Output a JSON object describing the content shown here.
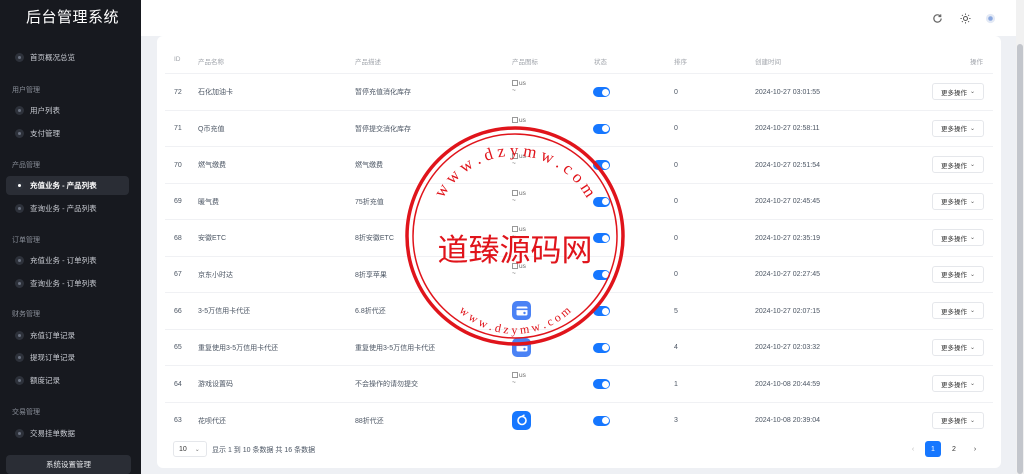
{
  "app": {
    "title": "后台管理系统"
  },
  "sidebar": {
    "groups": [
      {
        "title": "",
        "items": [
          {
            "label": "首页概况总览",
            "active": false
          }
        ]
      },
      {
        "title": "用户管理",
        "items": [
          {
            "label": "用户列表",
            "active": false
          },
          {
            "label": "支付管理",
            "active": false
          }
        ]
      },
      {
        "title": "产品管理",
        "items": [
          {
            "label": "充值业务 - 产品列表",
            "active": true
          },
          {
            "label": "查询业务 - 产品列表",
            "active": false
          }
        ]
      },
      {
        "title": "订单管理",
        "items": [
          {
            "label": "充值业务 - 订单列表",
            "active": false
          },
          {
            "label": "查询业务 - 订单列表",
            "active": false
          }
        ]
      },
      {
        "title": "财务管理",
        "items": [
          {
            "label": "充值订单记录",
            "active": false
          },
          {
            "label": "提现订单记录",
            "active": false
          },
          {
            "label": "额度记录",
            "active": false
          }
        ]
      },
      {
        "title": "交易管理",
        "items": [
          {
            "label": "交易挂单数据",
            "active": false
          }
        ]
      }
    ],
    "system_button": "系统设置管理"
  },
  "header": {
    "icons": [
      "refresh-icon",
      "sun-icon",
      "avatar-icon"
    ]
  },
  "table": {
    "columns": [
      "ID",
      "产品名称",
      "产品描述",
      "产品图标",
      "状态",
      "排序",
      "创建时间",
      "操作"
    ],
    "rows": [
      {
        "id": "72",
        "name": "石化加油卡",
        "desc": "暂停充值消化库存",
        "icon": "broken",
        "icon_text": "us\n~",
        "status": true,
        "sort": "0",
        "created": "2024-10-27 03:01:55",
        "action": "更多操作"
      },
      {
        "id": "71",
        "name": "Q币充值",
        "desc": "暂停提交消化库存",
        "icon": "broken",
        "icon_text": "us\n~",
        "status": true,
        "sort": "0",
        "created": "2024-10-27 02:58:11",
        "action": "更多操作"
      },
      {
        "id": "70",
        "name": "燃气缴费",
        "desc": "燃气缴费",
        "icon": "broken",
        "icon_text": "us\n~",
        "status": true,
        "sort": "0",
        "created": "2024-10-27 02:51:54",
        "action": "更多操作"
      },
      {
        "id": "69",
        "name": "暖气费",
        "desc": "75折充值",
        "icon": "broken",
        "icon_text": "us\n~",
        "status": true,
        "sort": "0",
        "created": "2024-10-27 02:45:45",
        "action": "更多操作"
      },
      {
        "id": "68",
        "name": "安徽ETC",
        "desc": "8折安徽ETC",
        "icon": "broken",
        "icon_text": "us\n~",
        "status": true,
        "sort": "0",
        "created": "2024-10-27 02:35:19",
        "action": "更多操作"
      },
      {
        "id": "67",
        "name": "京东小时达",
        "desc": "8折享苹果",
        "icon": "broken",
        "icon_text": "us\n~",
        "status": true,
        "sort": "0",
        "created": "2024-10-27 02:27:45",
        "action": "更多操作"
      },
      {
        "id": "66",
        "name": "3-5万信用卡代还",
        "desc": "6.8折代还",
        "icon": "card",
        "icon_text": "",
        "status": true,
        "sort": "5",
        "created": "2024-10-27 02:07:15",
        "action": "更多操作"
      },
      {
        "id": "65",
        "name": "重复使用3-5万信用卡代还",
        "desc": "重复使用3-5万信用卡代还",
        "icon": "card",
        "icon_text": "",
        "status": true,
        "sort": "4",
        "created": "2024-10-27 02:03:32",
        "action": "更多操作"
      },
      {
        "id": "64",
        "name": "游戏设置码",
        "desc": "不会操作的请勿提交",
        "icon": "broken",
        "icon_text": "us\n~",
        "status": true,
        "sort": "1",
        "created": "2024-10-08 20:44:59",
        "action": "更多操作"
      },
      {
        "id": "63",
        "name": "花呗代还",
        "desc": "88折代还",
        "icon": "huabei",
        "icon_text": "",
        "status": true,
        "sort": "3",
        "created": "2024-10-08 20:39:04",
        "action": "更多操作"
      }
    ]
  },
  "pagination": {
    "page_size": "10",
    "summary": "显示 1 到 10 条数据 共 16 条数据",
    "pages": [
      "1",
      "2"
    ],
    "current_page": "1",
    "prev": "‹",
    "next": "›"
  },
  "watermark": {
    "center_text": "道臻源码网",
    "top_text": "w w w . d z y m w . c o m",
    "bottom_text": "w w w . d z y m w . c o m",
    "color": "#e0141b"
  }
}
